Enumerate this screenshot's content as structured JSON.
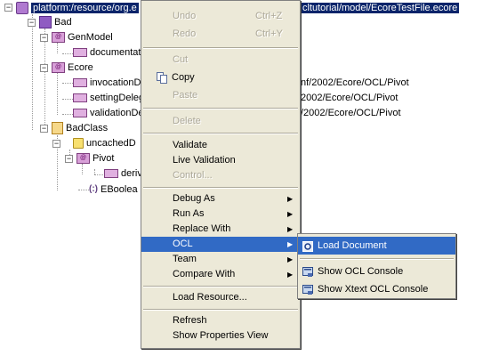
{
  "tree": {
    "root_prefix": "platform:/resource/org.e",
    "root_suffix": "cltutorial/model/EcoreTestFile.ecore",
    "bad": "Bad",
    "genmodel": "GenModel",
    "documentation": "documentat",
    "ecore": "Ecore",
    "invocation": "invocationD",
    "invocation_tail": "nf/2002/Ecore/OCL/Pivot",
    "setting": "settingDeleg",
    "setting_tail": "2002/Ecore/OCL/Pivot",
    "validation": "validationDe",
    "validation_tail": "/2002/Ecore/OCL/Pivot",
    "badclass": "BadClass",
    "uncached": "uncachedD",
    "pivot": "Pivot",
    "derive": "deriv",
    "eboolean": "EBoolea",
    "eboolean_prefix": "(:)"
  },
  "menu": {
    "undo": "Undo",
    "undo_acc": "Ctrl+Z",
    "redo": "Redo",
    "redo_acc": "Ctrl+Y",
    "cut": "Cut",
    "copy": "Copy",
    "paste": "Paste",
    "delete": "Delete",
    "validate": "Validate",
    "live_validation": "Live Validation",
    "control": "Control...",
    "debug_as": "Debug As",
    "run_as": "Run As",
    "replace_with": "Replace With",
    "ocl": "OCL",
    "team": "Team",
    "compare_with": "Compare With",
    "load_resource": "Load Resource...",
    "refresh": "Refresh",
    "show_properties": "Show Properties View"
  },
  "submenu": {
    "load_document": "Load Document",
    "show_ocl_console": "Show OCL Console",
    "show_xtext_console": "Show Xtext OCL Console"
  },
  "colors": {
    "selection": "#316ac5",
    "menu_bg": "#ece9d8",
    "tree_selection": "#0a246a"
  }
}
